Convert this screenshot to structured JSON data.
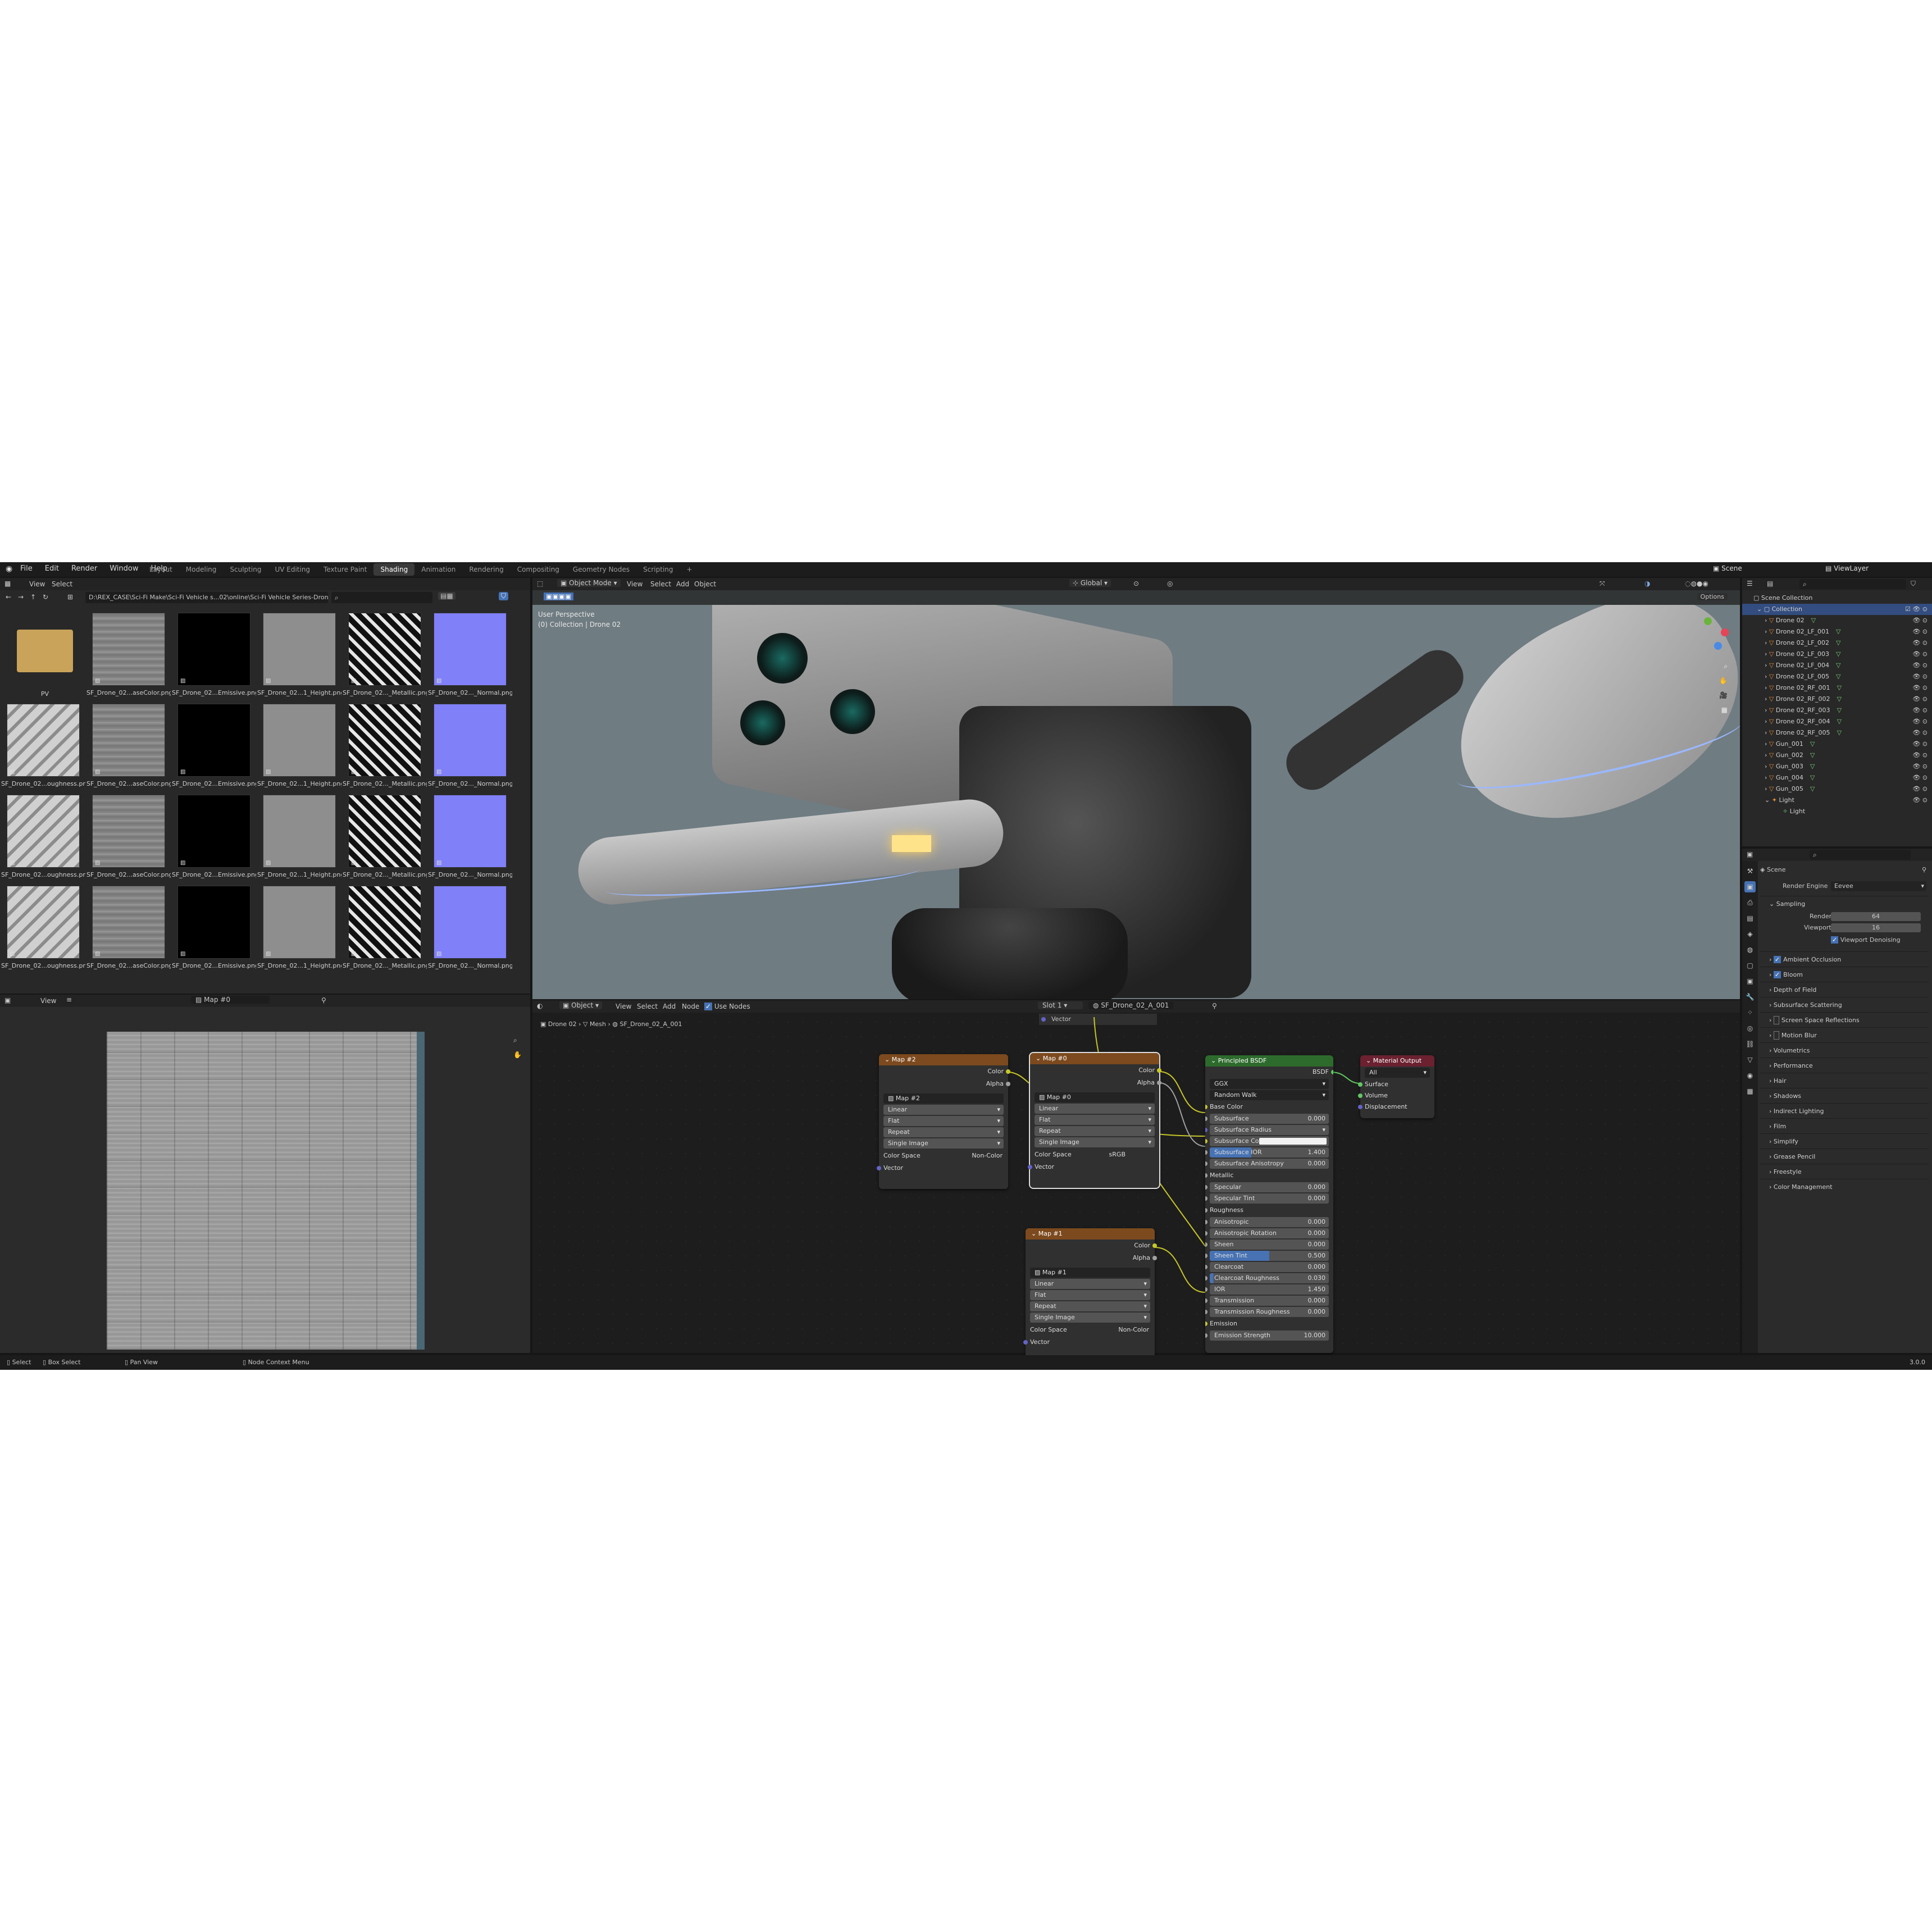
{
  "topbar": {
    "menus": [
      "File",
      "Edit",
      "Render",
      "Window",
      "Help"
    ],
    "workspaces": [
      "Layout",
      "Modeling",
      "Sculpting",
      "UV Editing",
      "Texture Paint",
      "Shading",
      "Animation",
      "Rendering",
      "Compositing",
      "Geometry Nodes",
      "Scripting"
    ],
    "active_workspace": "Shading",
    "add_tab": "+",
    "scene": "Scene",
    "view_layer": "ViewLayer"
  },
  "filebrowser": {
    "menus": [
      "View",
      "Select"
    ],
    "path": "D:\\REX_CASE\\Sci-Fi Make\\Sci-Fi Vehicle s...02\\online\\Sci-Fi Vehicle Series-Drone 02\\",
    "folder_label": "PV",
    "rows": [
      [
        "SF_Drone_02...aseColor.png",
        "SF_Drone_02...Emissive.png",
        "SF_Drone_02...1_Height.png",
        "SF_Drone_02..._Metallic.png",
        "SF_Drone_02..._Normal.png"
      ],
      [
        "SF_Drone_02...oughness.png",
        "SF_Drone_02...aseColor.png",
        "SF_Drone_02...Emissive.png",
        "SF_Drone_02...1_Height.png",
        "SF_Drone_02..._Metallic.png",
        "SF_Drone_02..._Normal.png"
      ],
      [
        "SF_Drone_02...oughness.png",
        "SF_Drone_02...aseColor.png",
        "SF_Drone_02...Emissive.png",
        "SF_Drone_02...1_Height.png",
        "SF_Drone_02..._Metallic.png",
        "SF_Drone_02..._Normal.png"
      ],
      [
        "SF_Drone_02...oughness.png",
        "SF_Drone_02...aseColor.png",
        "SF_Drone_02...Emissive.png",
        "SF_Drone_02...1_Height.png",
        "SF_Drone_02..._Metallic.png",
        "SF_Drone_02..._Normal.png"
      ]
    ]
  },
  "viewport": {
    "mode": "Object Mode",
    "menus": [
      "View",
      "Select",
      "Add",
      "Object"
    ],
    "transform": "Global",
    "options": "Options",
    "overlay_line1": "User Perspective",
    "overlay_line2": "(0) Collection | Drone 02"
  },
  "image_editor": {
    "view": "View",
    "image": "Map #0"
  },
  "node_editor": {
    "type": "Object",
    "menus": [
      "View",
      "Select",
      "Add",
      "Node"
    ],
    "use_nodes": "Use Nodes",
    "slot": "Slot 1",
    "material": "SF_Drone_02_A_001",
    "breadcrumb": [
      "Drone 02",
      "Mesh",
      "SF_Drone_02_A_001"
    ],
    "vector_socket": "Vector"
  },
  "nodes": {
    "map2": {
      "title": "Map #2",
      "image": "Map #2",
      "interp": "Linear",
      "proj": "Flat",
      "ext": "Repeat",
      "src": "Single Image",
      "cs_label": "Color Space",
      "cs": "Non-Color",
      "out_color": "Color",
      "out_alpha": "Alpha",
      "in_vector": "Vector"
    },
    "map0": {
      "title": "Map #0",
      "image": "Map #0",
      "interp": "Linear",
      "proj": "Flat",
      "ext": "Repeat",
      "src": "Single Image",
      "cs_label": "Color Space",
      "cs": "sRGB",
      "out_color": "Color",
      "out_alpha": "Alpha",
      "in_vector": "Vector"
    },
    "map1": {
      "title": "Map #1",
      "image": "Map #1",
      "interp": "Linear",
      "proj": "Flat",
      "ext": "Repeat",
      "src": "Single Image",
      "cs_label": "Color Space",
      "cs": "Non-Color",
      "out_color": "Color",
      "out_alpha": "Alpha",
      "in_vector": "Vector"
    },
    "bsdf": {
      "title": "Principled BSDF",
      "out": "BSDF",
      "dist": "GGX",
      "sss": "Random Walk",
      "base_color": "Base Color",
      "fields": [
        {
          "name": "Subsurface",
          "val": "0.000",
          "fill": 0
        },
        {
          "name": "Subsurface Radius",
          "val": "",
          "fill": 0,
          "dropdown": true
        },
        {
          "name": "Subsurface Co...",
          "val": "",
          "fill": 0,
          "swatch": true
        },
        {
          "name": "Subsurface IOR",
          "val": "1.400",
          "fill": 0.35
        },
        {
          "name": "Subsurface Anisotropy",
          "val": "0.000",
          "fill": 0
        }
      ],
      "metallic": "Metallic",
      "fields2": [
        {
          "name": "Specular",
          "val": "0.000",
          "fill": 0
        },
        {
          "name": "Specular Tint",
          "val": "0.000",
          "fill": 0
        }
      ],
      "roughness": "Roughness",
      "fields3": [
        {
          "name": "Anisotropic",
          "val": "0.000",
          "fill": 0
        },
        {
          "name": "Anisotropic Rotation",
          "val": "0.000",
          "fill": 0
        },
        {
          "name": "Sheen",
          "val": "0.000",
          "fill": 0
        },
        {
          "name": "Sheen Tint",
          "val": "0.500",
          "fill": 0.5
        },
        {
          "name": "Clearcoat",
          "val": "0.000",
          "fill": 0
        },
        {
          "name": "Clearcoat Roughness",
          "val": "0.030",
          "fill": 0.03
        },
        {
          "name": "IOR",
          "val": "1.450",
          "fill": 0
        },
        {
          "name": "Transmission",
          "val": "0.000",
          "fill": 0
        },
        {
          "name": "Transmission Roughness",
          "val": "0.000",
          "fill": 0
        }
      ],
      "emission": "Emission",
      "emission_strength": {
        "name": "Emission Strength",
        "val": "10.000"
      }
    },
    "output": {
      "title": "Material Output",
      "target": "All",
      "inputs": [
        "Surface",
        "Volume",
        "Displacement"
      ]
    }
  },
  "outliner": {
    "root": "Scene Collection",
    "collection": "Collection",
    "items": [
      "Drone 02",
      "Drone 02_LF_001",
      "Drone 02_LF_002",
      "Drone 02_LF_003",
      "Drone 02_LF_004",
      "Drone 02_LF_005",
      "Drone 02_RF_001",
      "Drone 02_RF_002",
      "Drone 02_RF_003",
      "Drone 02_RF_004",
      "Drone 02_RF_005",
      "Gun_001",
      "Gun_002",
      "Gun_003",
      "Gun_004",
      "Gun_005",
      "Light"
    ],
    "light_child": "Light"
  },
  "properties": {
    "scene": "Scene",
    "engine_label": "Render Engine",
    "engine": "Eevee",
    "sampling": "Sampling",
    "render_label": "Render",
    "render_val": "64",
    "viewport_label": "Viewport",
    "viewport_val": "16",
    "denoise": "Viewport Denoising",
    "sections": [
      "Ambient Occlusion",
      "Bloom",
      "Depth of Field",
      "Subsurface Scattering",
      "Screen Space Reflections",
      "Motion Blur",
      "Volumetrics",
      "Performance",
      "Hair",
      "Shadows",
      "Indirect Lighting",
      "Film",
      "Simplify",
      "Grease Pencil",
      "Freestyle",
      "Color Management"
    ]
  },
  "statusbar": {
    "select": "Select",
    "box_select": "Box Select",
    "pan": "Pan View",
    "context": "Node Context Menu",
    "version": "3.0.0"
  }
}
